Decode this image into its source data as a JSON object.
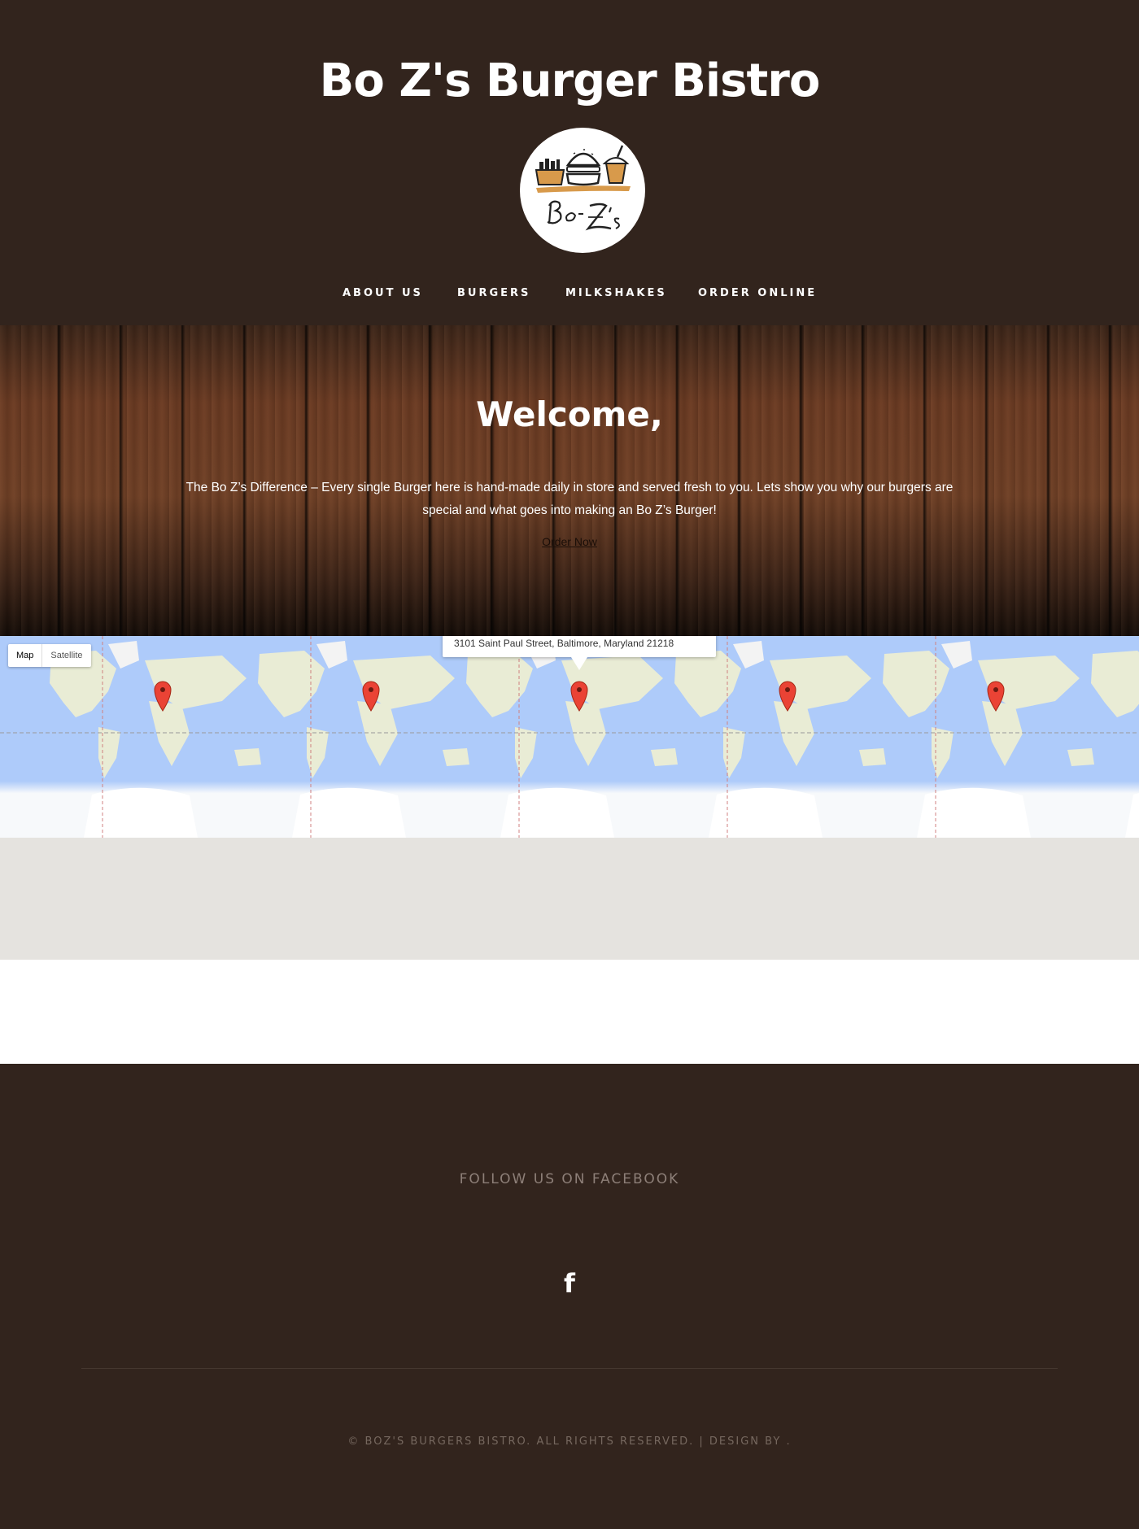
{
  "header": {
    "site_title": "Bo Z's Burger Bistro",
    "logo_text": "Bo Z's"
  },
  "nav": {
    "items": [
      {
        "label": "ABOUT US"
      },
      {
        "label": "BURGERS"
      },
      {
        "label": "MILKSHAKES"
      },
      {
        "label": "ORDER ONLINE"
      }
    ]
  },
  "hero": {
    "title": "Welcome,",
    "text": "The Bo Z’s Difference – Every single Burger here is hand-made daily in store and served fresh to you. Lets show you why our burgers are special and what goes into making an Bo Z’s Burger!",
    "link_label": "Order Now"
  },
  "map": {
    "type_map_label": "Map",
    "type_satellite_label": "Satellite",
    "info_address": "3101 Saint Paul Street, Baltimore, Maryland 21218",
    "marker_icon": "map-marker-icon"
  },
  "footer": {
    "follow_label": "FOLLOW US ON FACEBOOK",
    "facebook_icon": "facebook-icon",
    "facebook_glyph": "f",
    "copyright": "© BOZ'S BURGERS BISTRO. ALL RIGHTS RESERVED. | DESIGN BY ."
  },
  "colors": {
    "header_bg": "#32241d",
    "map_water": "#aecbfa",
    "map_land": "#e9ecd5",
    "marker": "#ea4335",
    "grey_band": "#e5e3df",
    "footer_text": "#8d7f78"
  }
}
